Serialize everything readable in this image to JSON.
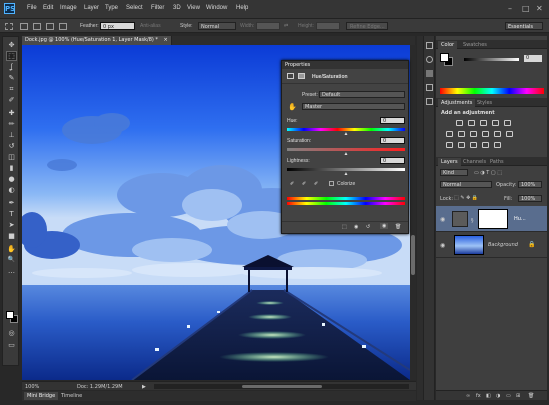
{
  "menubar": {
    "logo": "PS",
    "items": [
      "File",
      "Edit",
      "Image",
      "Layer",
      "Type",
      "Select",
      "Filter",
      "3D",
      "View",
      "Window",
      "Help"
    ],
    "window_controls": [
      "–",
      "□",
      "✕"
    ]
  },
  "options_bar": {
    "feather_label": "Feather:",
    "feather_value": "0 px",
    "antialias_label": "Anti-alias",
    "style_label": "Style:",
    "style_value": "Normal",
    "width_label": "Width:",
    "height_label": "Height:",
    "refine_edge_label": "Refine Edge...",
    "workspace_value": "Essentials"
  },
  "toolbar": {
    "tools": [
      "move",
      "marquee",
      "lasso",
      "quick-select",
      "crop",
      "eyedropper",
      "healing",
      "brush",
      "clone-stamp",
      "history-brush",
      "eraser",
      "gradient",
      "blur",
      "dodge",
      "pen",
      "type",
      "path-select",
      "shape",
      "hand",
      "zoom",
      "more",
      "color-swatch",
      "quick-mask",
      "screen-mode"
    ],
    "tool_glyphs": [
      "✥",
      "⬚",
      "ʆ",
      "✎",
      "⌗",
      "✐",
      "✚",
      "✏",
      "⊥",
      "↺",
      "◫",
      "▮",
      "●",
      "◐",
      "✒",
      "T",
      "➤",
      "■",
      "✋",
      "🔍",
      "…",
      "◩",
      "◎",
      "▭"
    ]
  },
  "document": {
    "tab_title": "Dock.jpg @ 100% (Hue/Saturation 1, Layer Mask/8) *",
    "close_glyph": "×",
    "zoom": "100%",
    "doc_info": "Doc: 1.29M/1.29M",
    "arrow_glyph": "▶"
  },
  "bottom_tabs": [
    "Mini Bridge",
    "Timeline"
  ],
  "properties": {
    "panel_title": "Properties",
    "adjustment_title": "Hue/Saturation",
    "preset_label": "Preset:",
    "preset_value": "Default",
    "channel_value": "Master",
    "hue_label": "Hue:",
    "hue_value": "0",
    "saturation_label": "Saturation:",
    "saturation_value": "0",
    "lightness_label": "Lightness:",
    "lightness_value": "0",
    "colorize_label": "Colorize",
    "hue_level": 0.5,
    "saturation_level": 0.5,
    "lightness_level": 0.5
  },
  "color_panel": {
    "tabs": [
      "Color",
      "Swatches"
    ],
    "value": "0"
  },
  "adjustments_panel": {
    "tabs": [
      "Adjustments",
      "Styles"
    ],
    "add_label": "Add an adjustment"
  },
  "layers_panel": {
    "tabs": [
      "Layers",
      "Channels",
      "Paths"
    ],
    "kind_value": "Kind",
    "blend_mode": "Normal",
    "opacity_label": "Opacity:",
    "opacity_value": "100%",
    "lock_label": "Lock:",
    "fill_label": "Fill:",
    "fill_value": "100%",
    "layers": [
      {
        "name": "Hu...",
        "visible": true
      },
      {
        "name": "Background",
        "visible": true
      }
    ],
    "footer_icons": [
      "∞",
      "fx",
      "◧",
      "◑",
      "▭",
      "⊞",
      "🗑"
    ]
  },
  "colors": {
    "menubar_bg": "#353535",
    "panel_bg": "#3f3f3f",
    "accent": "#4fb3ff"
  }
}
